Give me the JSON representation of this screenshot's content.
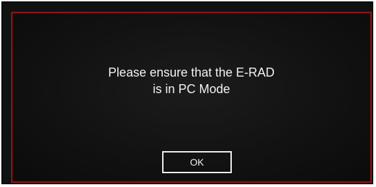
{
  "dialog": {
    "message_line1": "Please ensure that the E-RAD",
    "message_line2": "is in PC Mode",
    "ok_label": "OK"
  },
  "colors": {
    "background": "#111111",
    "border_accent": "#8a1418",
    "text": "#f2f2f2"
  }
}
